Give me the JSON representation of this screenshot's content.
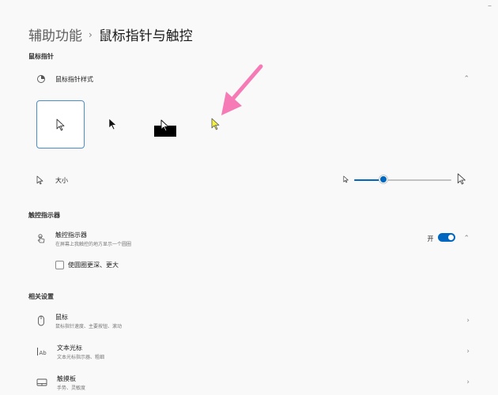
{
  "window": {
    "controls": [
      "–",
      "□"
    ]
  },
  "breadcrumb": {
    "parent": "辅助功能",
    "separator": "›",
    "current": "鼠标指针与触控"
  },
  "sections": {
    "pointer": {
      "label": "鼠标指针",
      "style_row": {
        "title": "鼠标指针样式",
        "icon": "pointer-style-icon",
        "chevron": "⌃"
      },
      "styles": [
        "white",
        "black",
        "inverted",
        "custom-yellow"
      ],
      "custom_colors": {
        "yellow": "#f4f142",
        "arrow_pink": "#f57ab6"
      },
      "size_row": {
        "title": "大小",
        "icon": "pointer-size-icon",
        "slider_fraction": 0.3
      }
    },
    "touch": {
      "label": "触控指示器",
      "indicator_row": {
        "title": "触控指示器",
        "subtitle": "在屏幕上我触控的地方显示一个圆圈",
        "toggle_label": "开",
        "toggle_on": true,
        "chevron": "⌃"
      },
      "checkbox": {
        "label": "使圆圈更深、更大",
        "checked": false
      }
    },
    "related": {
      "label": "相关设置",
      "items": [
        {
          "title": "鼠标",
          "subtitle": "鼠标指针速度、主要按钮、滚动",
          "icon": "mouse-icon",
          "chevron": "›"
        },
        {
          "title": "文本光标",
          "subtitle": "文本光标指示器、粗细",
          "icon": "text-cursor-icon",
          "chevron": "›"
        },
        {
          "title": "触摸板",
          "subtitle": "手势、灵敏度",
          "icon": "touchpad-icon",
          "chevron": "›"
        }
      ]
    }
  },
  "accent": "#0067c0"
}
